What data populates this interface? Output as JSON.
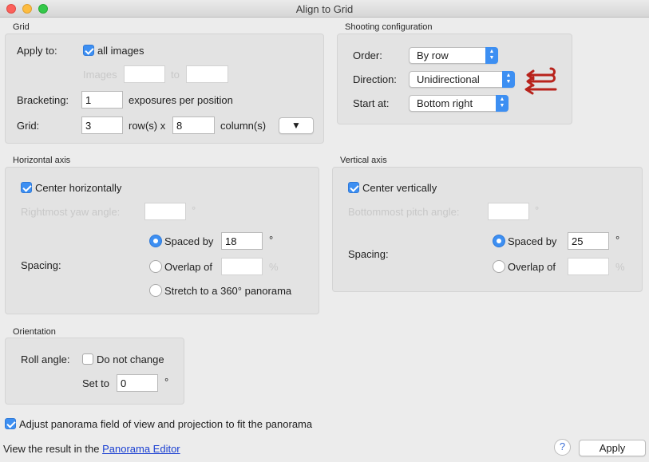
{
  "window": {
    "title": "Align to Grid"
  },
  "grid": {
    "section": "Grid",
    "apply_to_label": "Apply to:",
    "all_images_label": "all images",
    "all_images_checked": true,
    "images_label": "Images",
    "images_from": "",
    "to_label": "to",
    "images_to": "",
    "bracketing_label": "Bracketing:",
    "bracketing_value": "1",
    "exposures_label": "exposures per position",
    "grid_label": "Grid:",
    "rows_value": "3",
    "rows_label": "row(s) x",
    "cols_value": "8",
    "cols_label": "column(s)",
    "menu_glyph": "▼"
  },
  "shooting": {
    "section": "Shooting configuration",
    "order_label": "Order:",
    "order_value": "By row",
    "direction_label": "Direction:",
    "direction_value": "Unidirectional",
    "start_label": "Start at:",
    "start_value": "Bottom right",
    "arrow_color": "#b8231c"
  },
  "horizontal": {
    "section": "Horizontal axis",
    "center_label": "Center horizontally",
    "center_checked": true,
    "rightmost_label": "Rightmost yaw angle:",
    "rightmost_value": "",
    "rightmost_unit": "°",
    "spacing_label": "Spacing:",
    "spaced_by_label": "Spaced by",
    "spaced_by_value": "18",
    "spaced_unit": "°",
    "overlap_label": "Overlap of",
    "overlap_value": "",
    "overlap_unit": "%",
    "stretch_label": "Stretch to a 360° panorama",
    "selected": "spaced"
  },
  "vertical": {
    "section": "Vertical axis",
    "center_label": "Center vertically",
    "center_checked": true,
    "bottommost_label": "Bottommost pitch angle:",
    "bottommost_value": "",
    "bottommost_unit": "°",
    "spacing_label": "Spacing:",
    "spaced_by_label": "Spaced by",
    "spaced_by_value": "25",
    "spaced_unit": "°",
    "overlap_label": "Overlap of",
    "overlap_value": "",
    "overlap_unit": "%",
    "selected": "spaced"
  },
  "orientation": {
    "section": "Orientation",
    "roll_label": "Roll angle:",
    "do_not_change_label": "Do not change",
    "do_not_change_checked": false,
    "set_to_label": "Set to",
    "set_to_value": "0",
    "set_to_unit": "°"
  },
  "footer": {
    "adjust_label": "Adjust panorama field of view and projection to fit the panorama",
    "adjust_checked": true,
    "view_result_prefix": "View the result in the",
    "panorama_editor_link": "Panorama Editor",
    "help_glyph": "?",
    "apply_label": "Apply"
  },
  "colors": {
    "accent": "#3d8ff2",
    "link": "#1a3fd1",
    "background": "#ececec"
  }
}
